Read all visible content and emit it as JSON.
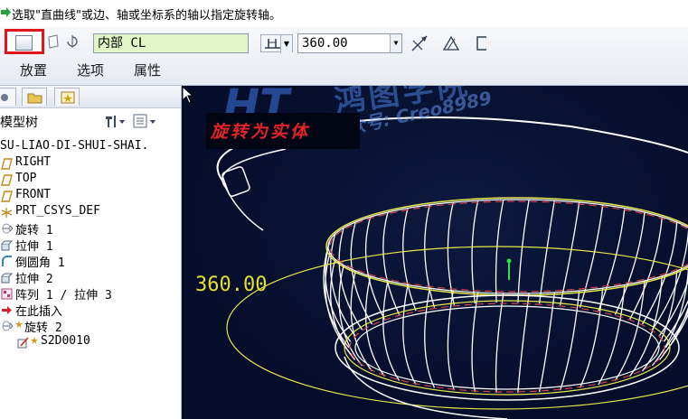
{
  "prompt": {
    "text": "选取\"直曲线\"或边、轴或坐标系的轴以指定旋转轴。",
    "arrow_color": "#2c9e3a"
  },
  "dashboard": {
    "solid_button_highlight": "#e0151b",
    "axis_field": {
      "value": "内部 CL",
      "bg": "#e3f5c6"
    },
    "angle_field": {
      "value": "360.00"
    },
    "tabs": [
      "放置",
      "选项",
      "属性"
    ]
  },
  "model_tree": {
    "title": "模型树",
    "items": [
      {
        "label": "SU-LIAO-DI-SHUI-SHAI.",
        "icon": "part-icon"
      },
      {
        "label": "RIGHT",
        "icon": "datum-plane-icon"
      },
      {
        "label": "TOP",
        "icon": "datum-plane-icon"
      },
      {
        "label": "FRONT",
        "icon": "datum-plane-icon"
      },
      {
        "label": "PRT_CSYS_DEF",
        "icon": "csys-icon"
      },
      {
        "label": "旋转 1",
        "icon": "revolve-icon"
      },
      {
        "label": "拉伸 1",
        "icon": "extrude-icon"
      },
      {
        "label": "倒圆角 1",
        "icon": "round-icon"
      },
      {
        "label": "拉伸 2",
        "icon": "extrude-icon"
      },
      {
        "label": "阵列 1 / 拉伸 3",
        "icon": "pattern-icon"
      },
      {
        "label": "在此插入",
        "icon": "insert-here-icon"
      },
      {
        "label": "旋转 2",
        "icon": "revolve-icon"
      },
      {
        "label": "S2D0010",
        "icon": "sketch-icon"
      }
    ]
  },
  "viewport": {
    "annotation": "旋转为实体",
    "dimension": "360.00",
    "watermark_title": "鸿图学院",
    "watermark_sub": "微信公众号: Creo8989",
    "watermark_logo": "HT",
    "bg": "#07112f",
    "model_color": "#ffffff",
    "section_color": "#e8e84a"
  }
}
